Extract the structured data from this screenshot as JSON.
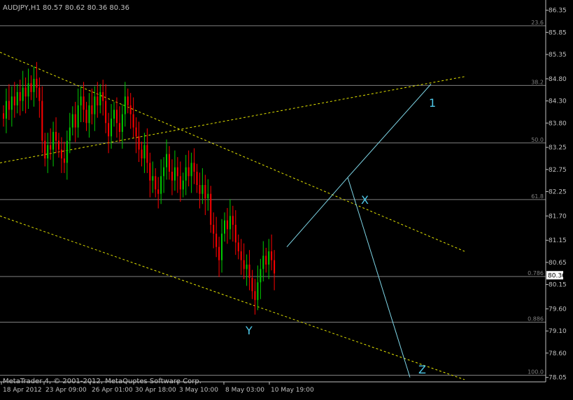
{
  "window": {
    "header": "AUDJPY,H1  80.57 80.62 80.36 80.36",
    "footer": "MetaTrader 4, © 2001-2012, MetaQuotes Software Corp."
  },
  "colors": {
    "background": "#000000",
    "frame": "#c0c0c0",
    "text": "#c0c0c0",
    "bull_candle": "#00cc00",
    "bear_candle": "#ff0000",
    "channel_line": "#e5e500",
    "fibo_level": "#808080",
    "wave_line": "#7fd7e8",
    "wave_label": "#4fc8e8",
    "price_box_bg": "#ffffff",
    "price_box_text": "#000000"
  },
  "chart_data": {
    "type": "candlestick",
    "symbol": "AUDJPY",
    "timeframe": "H1",
    "ohlc": {
      "open": 80.57,
      "high": 80.62,
      "low": 80.36,
      "close": 80.36
    },
    "current_price": "80.36",
    "ylim": [
      77.95,
      86.55
    ],
    "y_ticks": [
      "86.35",
      "85.85",
      "85.35",
      "84.80",
      "84.30",
      "83.80",
      "83.25",
      "82.75",
      "82.25",
      "81.70",
      "81.15",
      "80.65",
      "80.15",
      "79.60",
      "79.10",
      "78.60",
      "78.05"
    ],
    "x_tick_labels": [
      "18 Apr 2012",
      "23 Apr 09:00",
      "26 Apr 01:00",
      "30 Apr 18:00",
      "3 May 10:00",
      "8 May 03:00",
      "10 May 19:00"
    ],
    "fibo_levels": [
      {
        "label": "23.6",
        "price": 86.0
      },
      {
        "label": "38.2",
        "price": 84.65
      },
      {
        "label": "50.0",
        "price": 83.35
      },
      {
        "label": "61.8",
        "price": 82.07
      },
      {
        "label": "0.786",
        "price": 80.33
      },
      {
        "label": "0.886",
        "price": 79.3
      },
      {
        "label": "100.0",
        "price": 78.1
      }
    ],
    "price_path": [
      83.9,
      84.3,
      84.1,
      84.4,
      84.2,
      84.5,
      84.3,
      84.6,
      84.4,
      84.7,
      84.5,
      84.8,
      84.6,
      84.3,
      83.4,
      83.0,
      83.3,
      83.2,
      83.6,
      83.4,
      83.2,
      83.0,
      82.9,
      83.4,
      83.7,
      84.0,
      83.7,
      84.2,
      84.4,
      84.1,
      83.8,
      84.2,
      84.0,
      84.4,
      84.2,
      84.5,
      84.3,
      83.8,
      83.5,
      83.9,
      84.1,
      83.8,
      83.6,
      84.0,
      84.4,
      84.2,
      84.0,
      83.7,
      83.5,
      83.2,
      83.0,
      83.3,
      82.9,
      82.5,
      82.6,
      82.3,
      82.2,
      82.6,
      82.8,
      83.1,
      82.7,
      82.5,
      82.8,
      82.6,
      82.3,
      82.5,
      82.8,
      82.6,
      82.9,
      82.7,
      82.4,
      82.2,
      82.4,
      82.1,
      82.2,
      81.5,
      81.3,
      81.0,
      80.7,
      81.3,
      81.6,
      81.4,
      81.7,
      81.5,
      81.1,
      80.9,
      80.7,
      80.5,
      80.6,
      80.3,
      80.0,
      79.8,
      80.2,
      80.5,
      80.8,
      80.6,
      80.9,
      80.7,
      80.4
    ],
    "channels": [
      {
        "name": "upper-channel",
        "from": [
          "18 Apr 2012",
          85.4
        ],
        "to": [
          "10 May 19:00",
          80.9
        ]
      },
      {
        "name": "lower-channel",
        "from": [
          "18 Apr 2012",
          81.7
        ],
        "to": [
          "10 May 19:00",
          78.0
        ]
      },
      {
        "name": "rising-line",
        "from": [
          "18 Apr 2012",
          82.9
        ],
        "to": [
          "10 May 19:00",
          84.85
        ]
      }
    ],
    "wave_labels": [
      "1",
      "X",
      "Y",
      "Z"
    ],
    "x_axis": "time",
    "y_axis": "price",
    "grid": false,
    "legend": "none"
  }
}
